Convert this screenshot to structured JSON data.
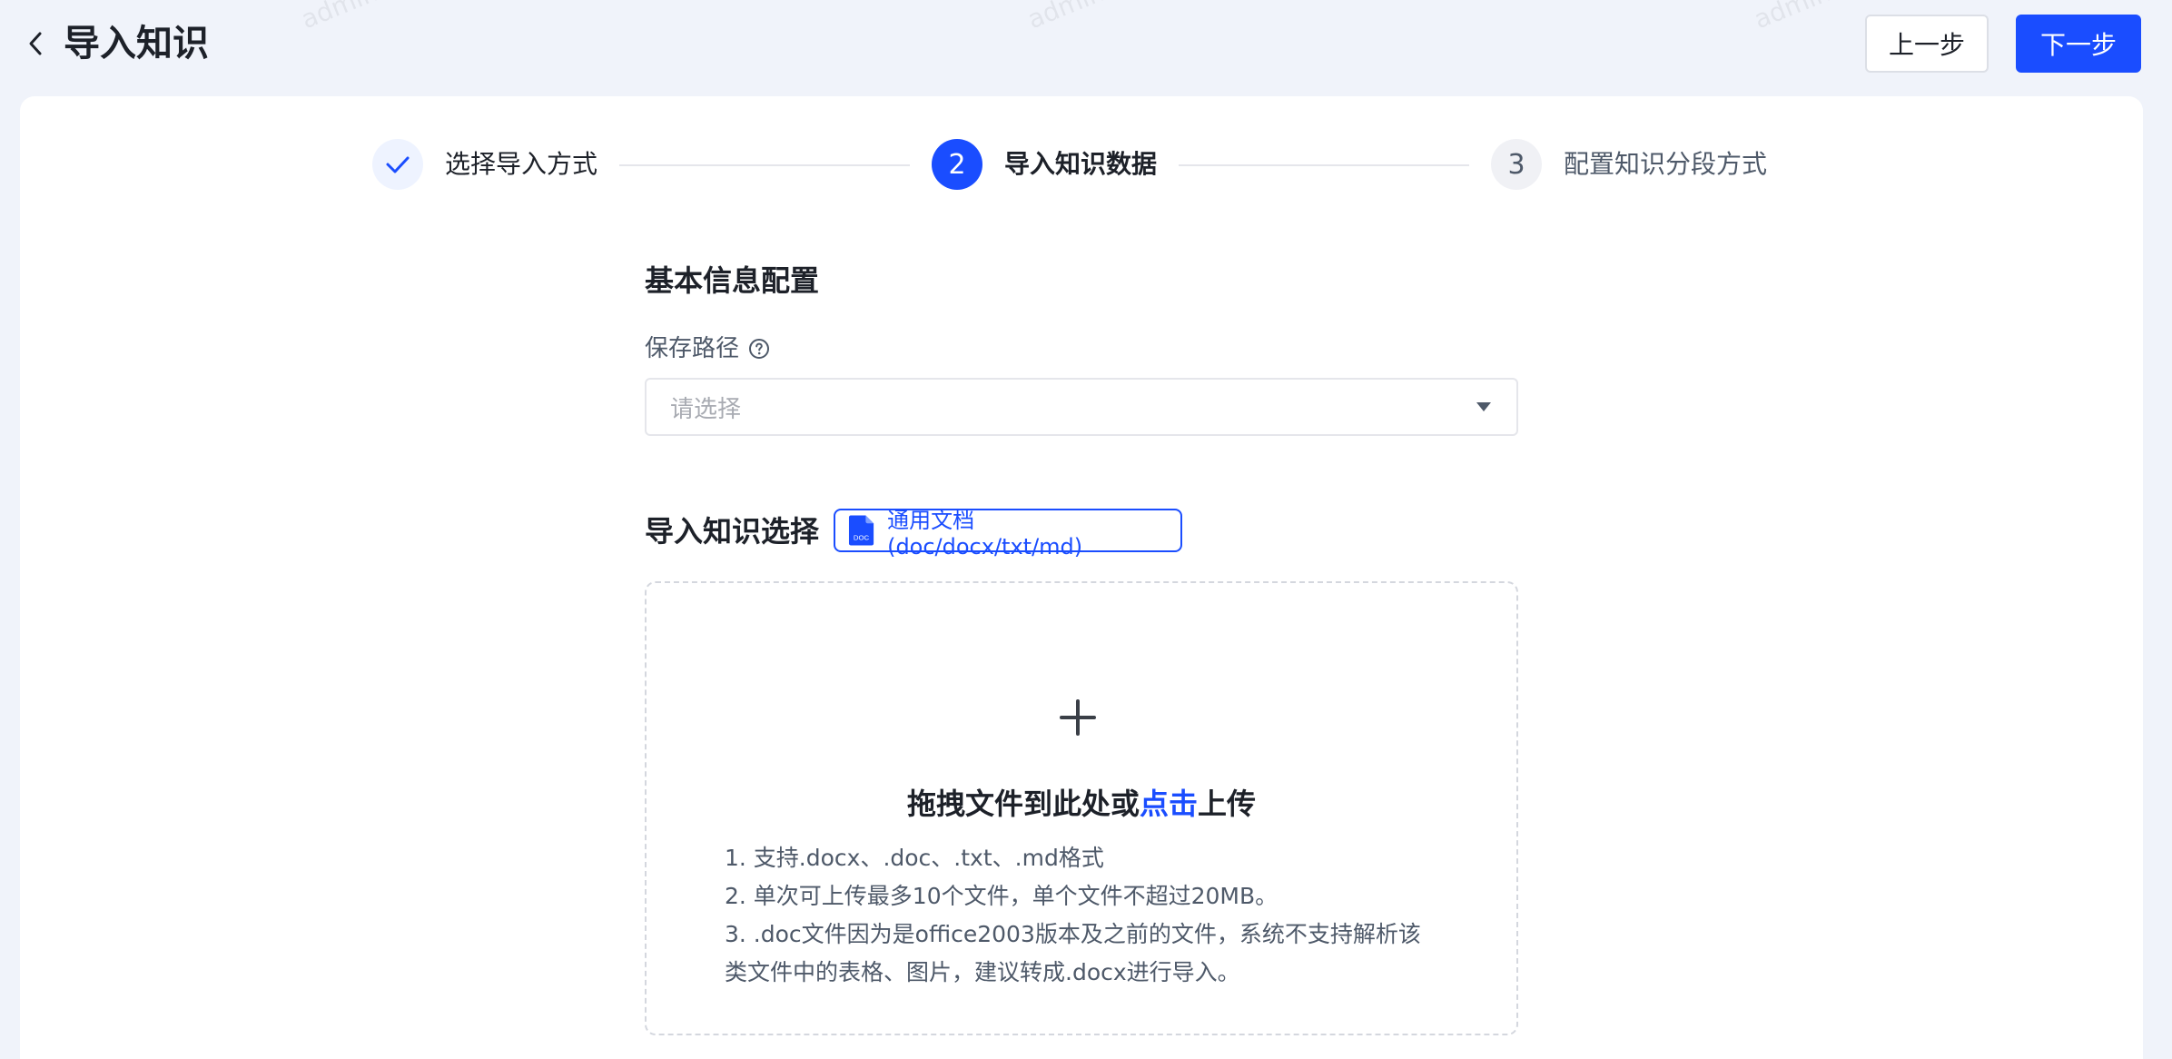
{
  "header": {
    "title": "导入知识",
    "prev_label": "上一步",
    "next_label": "下一步"
  },
  "watermark": "admin",
  "steps": [
    {
      "label": "选择导入方式",
      "number": "",
      "status": "done"
    },
    {
      "label": "导入知识数据",
      "number": "2",
      "status": "active"
    },
    {
      "label": "配置知识分段方式",
      "number": "3",
      "status": "todo"
    }
  ],
  "basic_info": {
    "title": "基本信息配置",
    "save_path_label": "保存路径",
    "save_path_placeholder": "请选择"
  },
  "import_select": {
    "title": "导入知识选择",
    "type_tag": "通用文档 (doc/docx/txt/md)",
    "doc_icon_text": "DOC"
  },
  "upload": {
    "title_before": "拖拽文件到此处或",
    "title_link": "点击",
    "title_after": "上传",
    "tips": [
      "1. 支持.docx、.doc、.txt、.md格式",
      "2. 单次可上传最多10个文件，单个文件不超过20MB。",
      "3. .doc文件因为是office2003版本及之前的文件，系统不支持解析该类文件中的表格、图片，建议转成.docx进行导入。"
    ]
  },
  "colors": {
    "primary": "#1a4dff",
    "background": "#f0f3fa",
    "text": "#1d2129",
    "muted": "#4e5969"
  }
}
